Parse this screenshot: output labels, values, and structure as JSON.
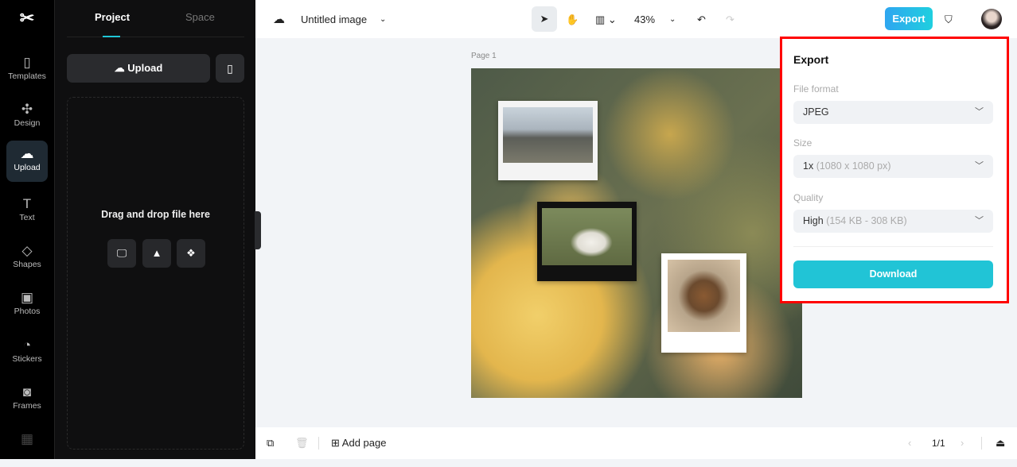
{
  "rail": {
    "items": [
      {
        "label": "Templates",
        "icon": "templates-icon"
      },
      {
        "label": "Design",
        "icon": "design-icon"
      },
      {
        "label": "Upload",
        "icon": "upload-cloud-icon"
      },
      {
        "label": "Text",
        "icon": "text-icon"
      },
      {
        "label": "Shapes",
        "icon": "shapes-icon"
      },
      {
        "label": "Photos",
        "icon": "photos-icon"
      },
      {
        "label": "Stickers",
        "icon": "stickers-icon"
      },
      {
        "label": "Frames",
        "icon": "frames-icon"
      }
    ]
  },
  "panel": {
    "tabs": [
      "Project",
      "Space"
    ],
    "upload_label": "Upload",
    "drop_text": "Drag and drop file here"
  },
  "topbar": {
    "title": "Untitled image",
    "zoom": "43%",
    "export_label": "Export"
  },
  "canvas": {
    "page_label": "Page 1"
  },
  "export": {
    "title": "Export",
    "format_label": "File format",
    "format_value": "JPEG",
    "size_label": "Size",
    "size_value": "1x",
    "size_detail": "(1080 x 1080 px)",
    "quality_label": "Quality",
    "quality_value": "High",
    "quality_detail": "(154 KB - 308 KB)",
    "download_label": "Download"
  },
  "bottombar": {
    "add_page": "Add page",
    "page_counter": "1/1"
  },
  "colors": {
    "accent": "#21c4d6",
    "highlight": "#ff0000"
  }
}
